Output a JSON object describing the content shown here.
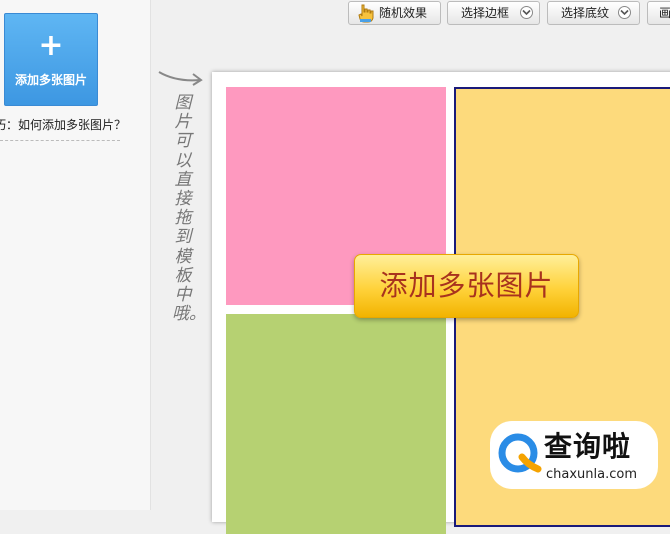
{
  "left_panel": {
    "add_button": {
      "icon": "plus-icon",
      "plus": "+",
      "label": "添加多张图片"
    },
    "tip": "巧：如何添加多张图片？"
  },
  "toolbar": {
    "random_effect": "随机效果",
    "select_border": "选择边框",
    "select_texture": "选择底纹",
    "last_button": "画"
  },
  "hint": "图片可以直接拖到模板中哦。",
  "canvas": {
    "center_button": "添加多张图片",
    "cell_colors": {
      "pink": "#fe99bf",
      "green": "#b6d172",
      "yellow": "#fdda7c",
      "frame": "#1a1a7a"
    }
  },
  "watermark": {
    "icon": "magnifier-q-logo",
    "title": "查询啦",
    "domain": "chaxunla.com"
  },
  "colors": {
    "accent_blue": "#3d97e2",
    "button_gold": "#ffd23a",
    "button_text": "#a8321e"
  }
}
